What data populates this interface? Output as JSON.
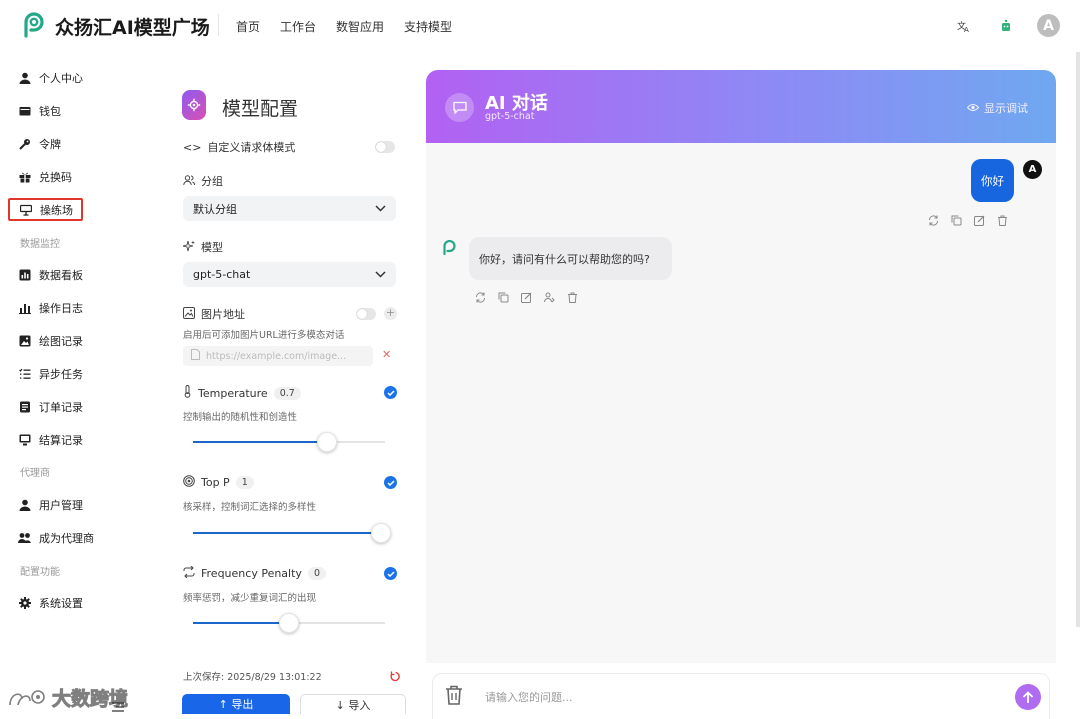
{
  "app": {
    "brand": "众扬汇AI模型广场"
  },
  "nav": [
    {
      "label": "首页"
    },
    {
      "label": "工作台"
    },
    {
      "label": "数智应用"
    },
    {
      "label": "支持模型"
    }
  ],
  "topbar": {
    "avatar_letter": "A"
  },
  "sidebar": {
    "items": [
      {
        "label": "个人中心"
      },
      {
        "label": "钱包"
      },
      {
        "label": "令牌"
      },
      {
        "label": "兑换码"
      },
      {
        "label": "操练场"
      },
      {
        "label": "数据看板"
      },
      {
        "label": "操作日志"
      },
      {
        "label": "绘图记录"
      },
      {
        "label": "异步任务"
      },
      {
        "label": "订单记录"
      },
      {
        "label": "结算记录"
      },
      {
        "label": "用户管理"
      },
      {
        "label": "成为代理商"
      },
      {
        "label": "系统设置"
      }
    ],
    "sections": [
      "数据监控",
      "代理商",
      "配置功能"
    ],
    "active_index": 4
  },
  "panel": {
    "title": "模型配置",
    "custom_body_label": "自定义请求体模式",
    "group_label": "分组",
    "group_value": "默认分组",
    "model_label": "模型",
    "model_value": "gpt-5-chat",
    "image_label": "图片地址",
    "image_hint": "启用后可添加图片URL进行多模态对话",
    "image_placeholder": "https://example.com/image...",
    "temperature": {
      "label": "Temperature",
      "value": "0.7",
      "hint": "控制输出的随机性和创造性",
      "fraction": 0.7
    },
    "top_p": {
      "label": "Top P",
      "value": "1",
      "hint": "核采样，控制词汇选择的多样性",
      "fraction": 1.0
    },
    "frequency_penalty": {
      "label": "Frequency Penalty",
      "value": "0",
      "hint": "频率惩罚，减少重复词汇的出现",
      "fraction": 0.5
    },
    "saved": "上次保存: 2025/8/29 13:01:22",
    "export_label": "↑ 导出",
    "import_label": "↓ 导入"
  },
  "chat": {
    "title": "AI 对话",
    "model": "gpt-5-chat",
    "debug_label": "显示调试",
    "user_message": "你好",
    "user_avatar": "A",
    "ai_message": "你好，请问有什么可以帮助您的吗?",
    "input_placeholder": "请输入您的问题..."
  },
  "watermark": {
    "text": "大数跨境"
  },
  "colors": {
    "accent": "#1a66e8",
    "purple": "#b261f2",
    "brand_green": "#23a98a",
    "active_outline": "#e0362c"
  }
}
